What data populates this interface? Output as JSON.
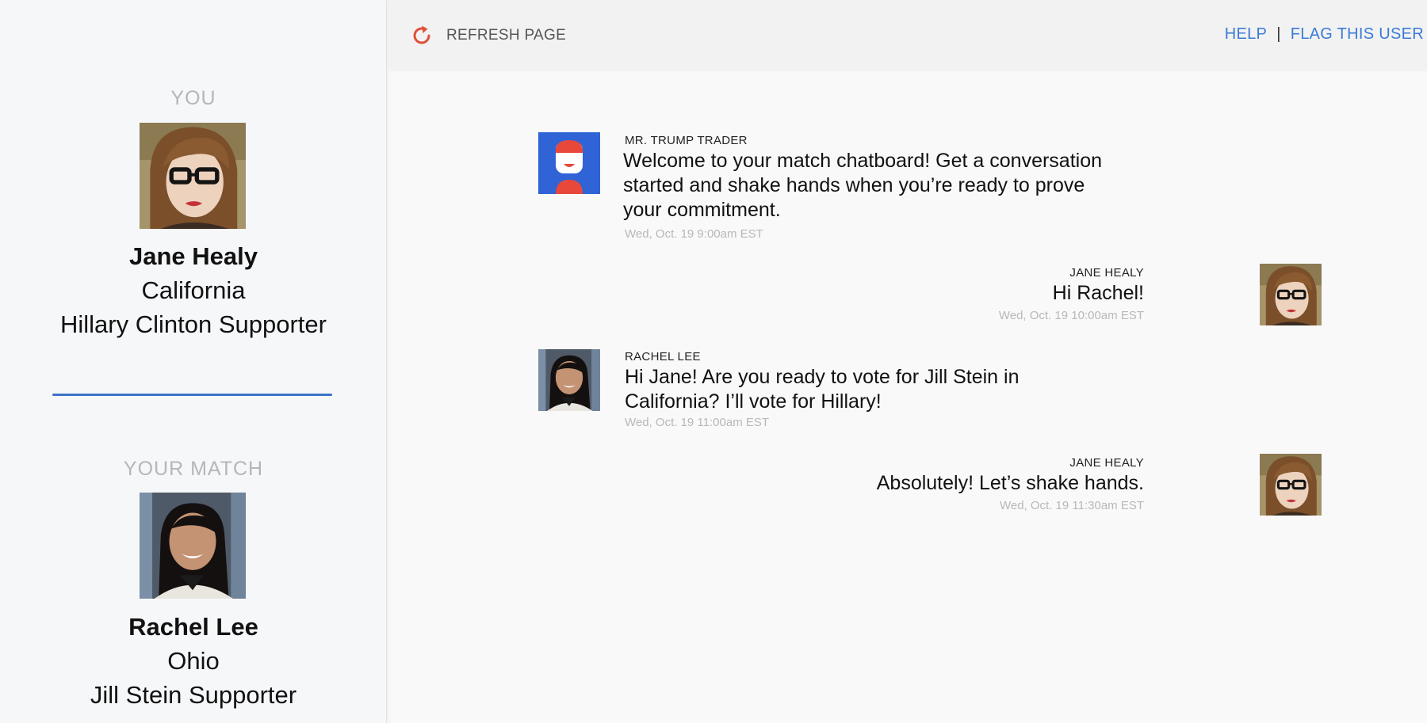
{
  "sidebar": {
    "you": {
      "label": "YOU",
      "name": "Jane Healy",
      "state": "California",
      "support": "Hillary Clinton Supporter"
    },
    "match": {
      "label": "YOUR MATCH",
      "name": "Rachel Lee",
      "state": "Ohio",
      "support": "Jill Stein Supporter"
    },
    "divider_color": "#3a73c9"
  },
  "topbar": {
    "refresh_icon": "refresh-icon",
    "refresh_label": "REFRESH PAGE",
    "help_label": "HELP",
    "separator": "|",
    "flag_label": "FLAG THIS USER",
    "accent_color": "#3a7bd5",
    "refresh_icon_color": "#e0503a"
  },
  "messages": [
    {
      "sender": "MR. TRUMP TRADER",
      "line1": "Welcome to your match chatboard! Get a conversation",
      "line2": "started and shake hands when you’re ready to prove",
      "line3": "your commitment.",
      "time": "Wed, Oct. 19 9:00am EST",
      "avatar": "bot-logo"
    },
    {
      "sender": "JANE HEALY",
      "line1": "Hi Rachel!",
      "time": "Wed, Oct. 19 10:00am EST",
      "avatar": "jane-photo"
    },
    {
      "sender": "RACHEL LEE",
      "line1": "Hi Jane! Are you ready to vote for Jill Stein in",
      "line2": "California? I’ll vote for Hillary!",
      "time": "Wed, Oct. 19 11:00am EST",
      "avatar": "rachel-photo"
    },
    {
      "sender": "JANE HEALY",
      "line1": "Absolutely! Let’s shake hands.",
      "time": "Wed, Oct. 19 11:30am EST",
      "avatar": "jane-photo"
    }
  ]
}
